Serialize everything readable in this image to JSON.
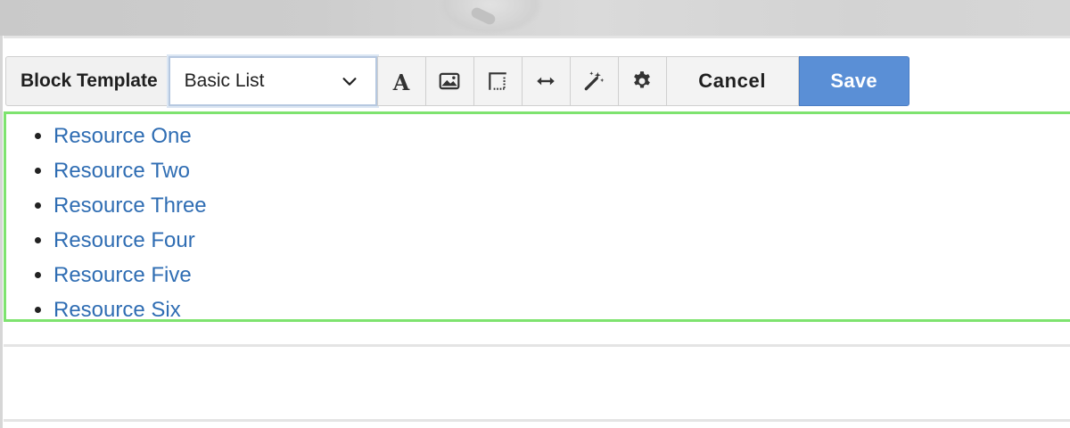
{
  "toolbar": {
    "label": "Block Template",
    "template_select": {
      "value": "Basic List"
    },
    "icons": [
      {
        "name": "text-format-icon"
      },
      {
        "name": "image-icon"
      },
      {
        "name": "border-icon"
      },
      {
        "name": "width-arrows-icon"
      },
      {
        "name": "magic-wand-icon"
      },
      {
        "name": "gear-icon"
      }
    ],
    "cancel_label": "Cancel",
    "save_label": "Save"
  },
  "content": {
    "items": [
      {
        "label": "Resource One"
      },
      {
        "label": "Resource Two"
      },
      {
        "label": "Resource Three"
      },
      {
        "label": "Resource Four"
      },
      {
        "label": "Resource Five"
      },
      {
        "label": "Resource Six"
      }
    ]
  },
  "colors": {
    "save_button": "#5a8fd6",
    "link": "#2f6db3",
    "selection_outline": "#7ee36f"
  }
}
